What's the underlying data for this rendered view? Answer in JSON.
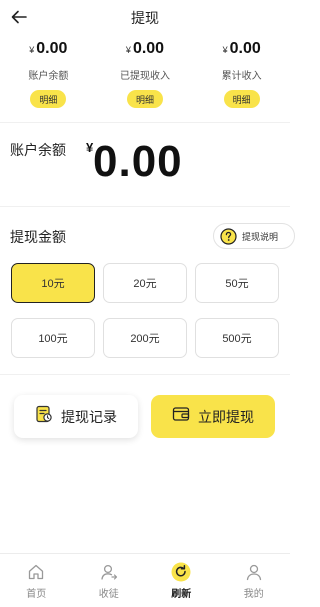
{
  "header": {
    "title": "提现",
    "back_icon": "back-arrow-icon"
  },
  "stats": [
    {
      "currency": "¥",
      "value": "0.00",
      "label": "账户余额",
      "detail": "明细"
    },
    {
      "currency": "¥",
      "value": "0.00",
      "label": "已提现收入",
      "detail": "明细"
    },
    {
      "currency": "¥",
      "value": "0.00",
      "label": "累计收入",
      "detail": "明细"
    }
  ],
  "balance": {
    "label": "账户余额",
    "currency": "¥",
    "value": "0.00"
  },
  "withdraw": {
    "title": "提现金额",
    "help_label": "提现说明",
    "options": [
      "10元",
      "20元",
      "50元",
      "100元",
      "200元",
      "500元"
    ],
    "selected": "10元"
  },
  "actions": {
    "record_label": "提现记录",
    "withdraw_now_label": "立即提现"
  },
  "tabbar": {
    "items": [
      {
        "label": "首页",
        "icon": "home-icon"
      },
      {
        "label": "收徒",
        "icon": "apprentice-icon"
      },
      {
        "label": "刷新",
        "icon": "refresh-icon"
      },
      {
        "label": "我的",
        "icon": "profile-icon"
      }
    ],
    "active": "刷新"
  },
  "colors": {
    "accent": "#f9e34a",
    "text": "#222222",
    "border": "#e0e0e0"
  }
}
